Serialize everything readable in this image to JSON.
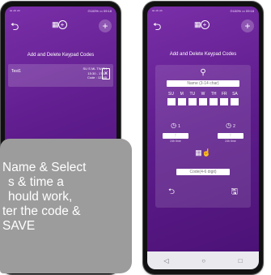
{
  "left_phone": {
    "status": {
      "left": "ᵃᵃ ⁴ᴳ ⁴ᴳ",
      "right": "⊙100% ▭ 09:18"
    },
    "title": "Add and Delete Keypad Codes",
    "codes": [
      {
        "name": "Test1",
        "meta_line1": "SU S ML TW TH",
        "meta_line2": "15:30 - 17:15",
        "meta_line3": "Code : 12345"
      }
    ],
    "icons": {
      "back": "back-arrow-icon",
      "add": "plus-icon",
      "logo": "keypad-plus-icon",
      "delete": "trash-icon"
    }
  },
  "overlay": {
    "lines": [
      "Name & Select",
      "s & time a",
      "hould work,",
      "ter the code &",
      "SAVE"
    ],
    "color": "#9c9c9c"
  },
  "right_phone": {
    "status": {
      "left": "ᵃᵃ ⁴ᴳ ⁴ᴳ",
      "right": "⊙100% ▭ 09:18"
    },
    "title": "Add and Delete Keypad Codes",
    "name_placeholder": "Name (3-14 char)",
    "days": [
      "SU",
      "M",
      "TU",
      "W",
      "TH",
      "FR",
      "SA"
    ],
    "time1": {
      "label": "1",
      "value": ":",
      "hint": "24h time"
    },
    "time2": {
      "label": "2",
      "value": ":",
      "hint": "24h time"
    },
    "code_placeholder": "Code(4-6 digit)",
    "icons": {
      "back": "back-arrow-icon",
      "add": "plus-icon",
      "save": "save-icon",
      "person": "person-icon",
      "clock": "clock-icon",
      "keypad": "keypad-icon"
    }
  },
  "navbar": {
    "back": "◁",
    "home": "○",
    "recent": "□"
  },
  "colors": {
    "accent": "#6a22a0",
    "nav": "#e9e9ee"
  }
}
